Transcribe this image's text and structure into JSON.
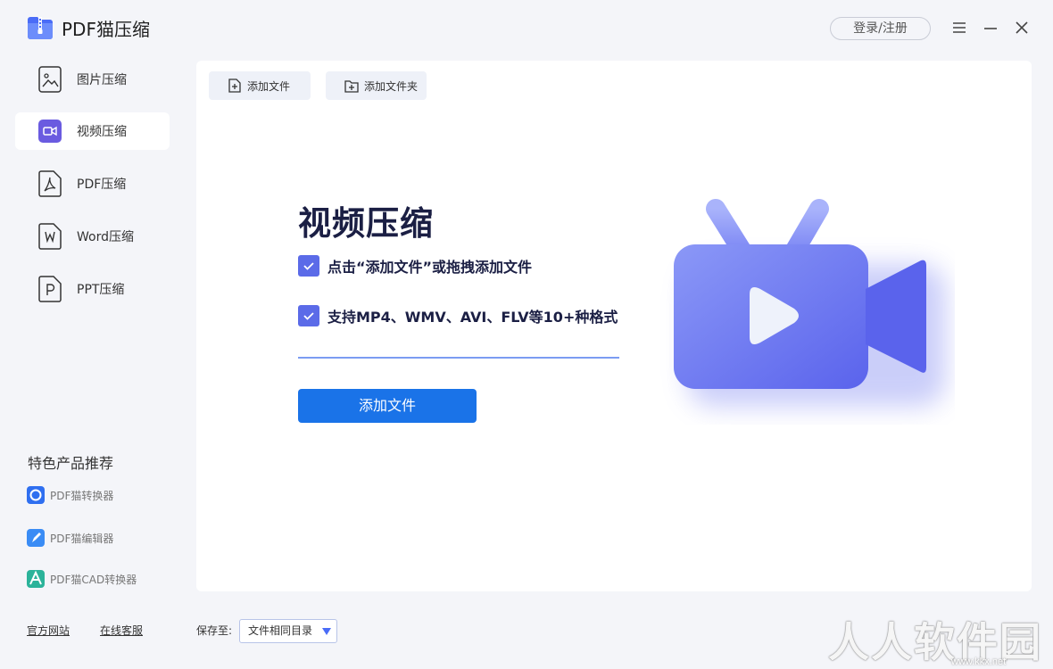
{
  "app": {
    "title": "PDF猫压缩",
    "login_label": "登录/注册"
  },
  "sidebar": {
    "items": [
      {
        "label": "图片压缩",
        "icon": "image-file-icon"
      },
      {
        "label": "视频压缩",
        "icon": "video-camera-icon",
        "active": true
      },
      {
        "label": "PDF压缩",
        "icon": "pdf-file-icon"
      },
      {
        "label": "Word压缩",
        "icon": "word-file-icon"
      },
      {
        "label": "PPT压缩",
        "icon": "ppt-file-icon"
      }
    ],
    "promo_title": "特色产品推荐",
    "promos": [
      {
        "label": "PDF猫转换器",
        "color": "#2f6ff0"
      },
      {
        "label": "PDF猫编辑器",
        "color": "#3a8cf5"
      },
      {
        "label": "PDF猫CAD转换器",
        "color": "#2bb39a"
      }
    ],
    "footer_links": [
      "官方网站",
      "在线客服"
    ]
  },
  "toolbar": {
    "add_file": "添加文件",
    "add_folder": "添加文件夹"
  },
  "main": {
    "title": "视频压缩",
    "tips": [
      "点击“添加文件”或拖拽添加文件",
      "支持MP4、WMV、AVI、FLV等10+种格式"
    ],
    "add_button": "添加文件"
  },
  "bottom": {
    "save_label": "保存至:",
    "save_value": "文件相同目录"
  },
  "watermark": {
    "text": "人人软件园",
    "url": "www.kkx.net"
  },
  "colors": {
    "accent": "#1a73e8",
    "check": "#5b6be8",
    "title": "#1b1f44",
    "video_purple": "#6a5be0"
  }
}
